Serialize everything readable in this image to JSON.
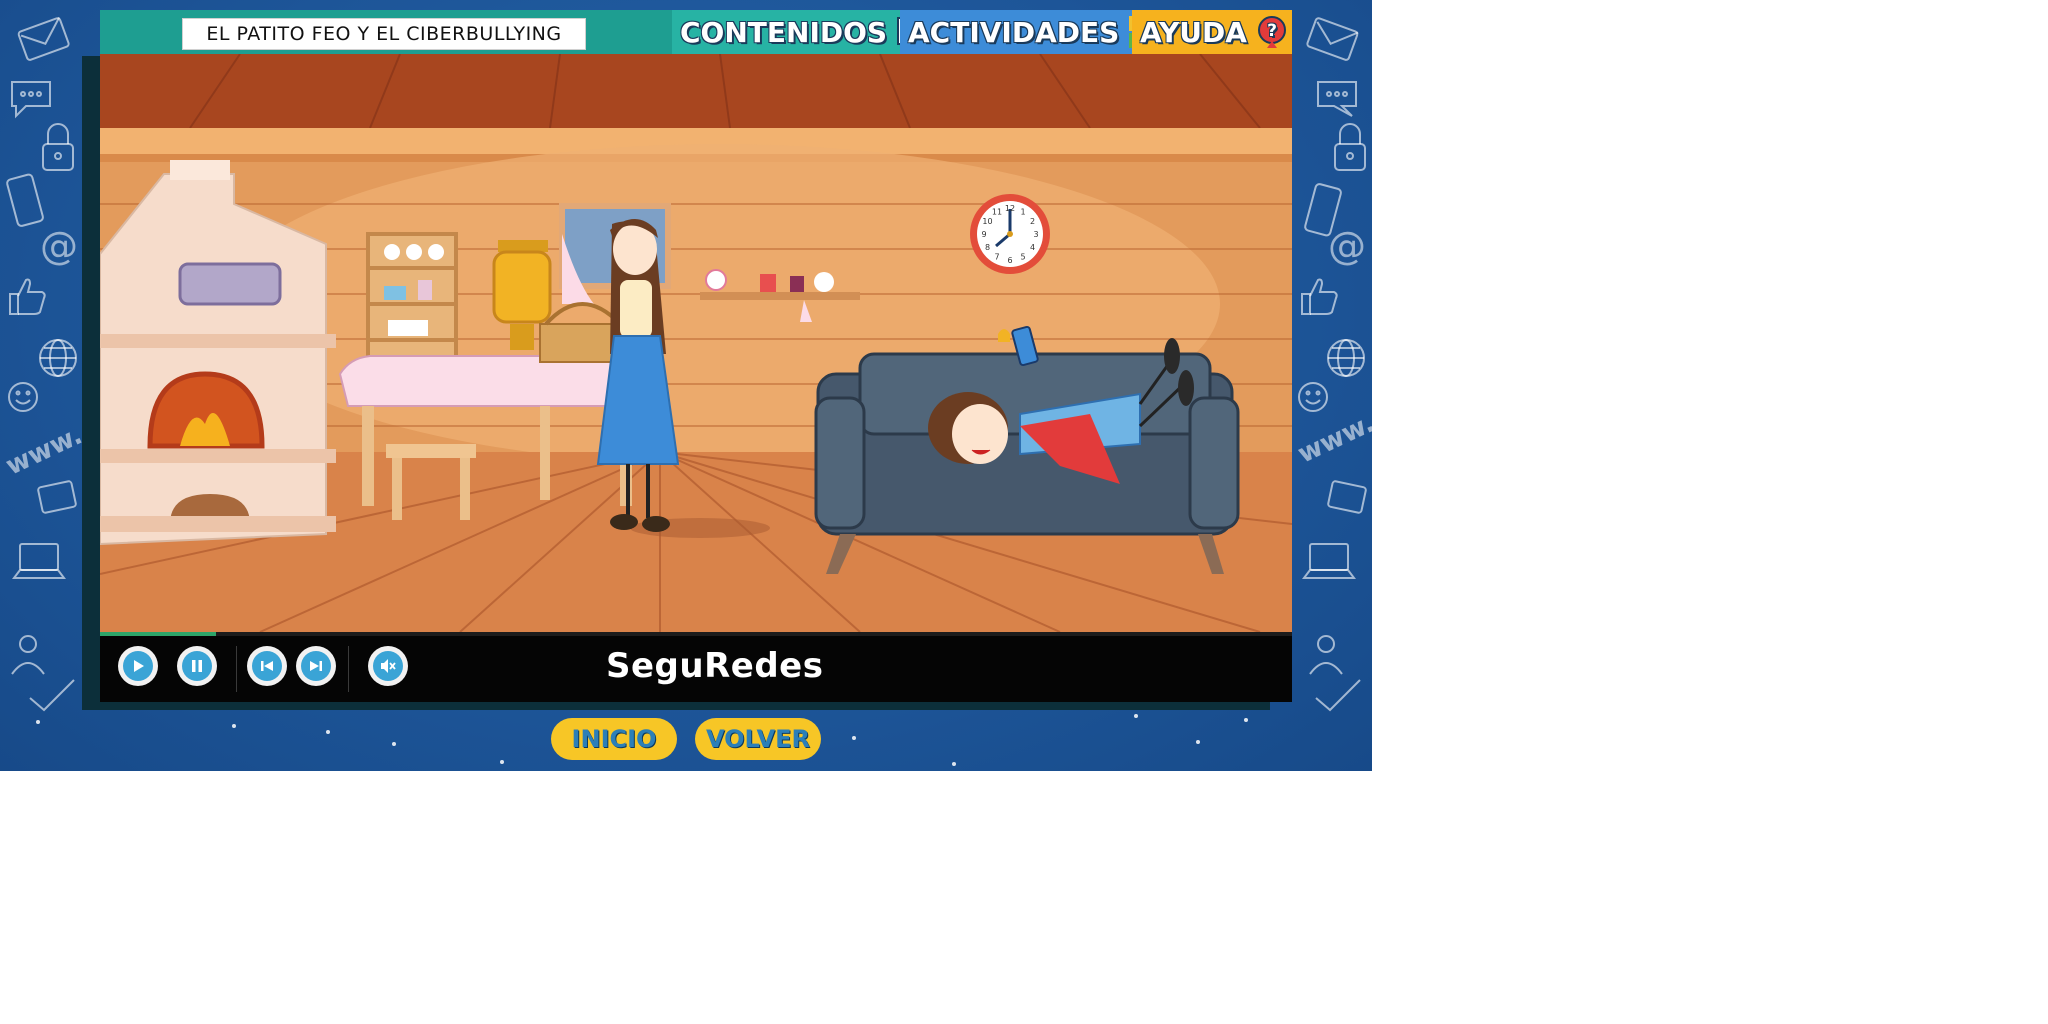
{
  "header": {
    "title": "EL PATITO FEO Y EL CIBERBULLYING",
    "nav": [
      {
        "label": "CONTENIDOS",
        "icon": "magnifier-book-icon",
        "color": "#27b3a4"
      },
      {
        "label": "ACTIVIDADES",
        "icon": "puzzle-icon",
        "color": "#3d8cd8"
      },
      {
        "label": "AYUDA",
        "icon": "question-icon",
        "color": "#f6b21e"
      }
    ]
  },
  "scene": {
    "clock_numbers": [
      "12",
      "1",
      "2",
      "3",
      "4",
      "5",
      "6",
      "7",
      "8",
      "9",
      "10",
      "11"
    ]
  },
  "player": {
    "brand": "SeguRedes",
    "progress": 0.097,
    "buttons": [
      "play-icon",
      "pause-icon",
      "previous-icon",
      "next-icon",
      "mute-icon"
    ]
  },
  "footer": {
    "inicio": "INICIO",
    "volver": "VOLVER"
  }
}
